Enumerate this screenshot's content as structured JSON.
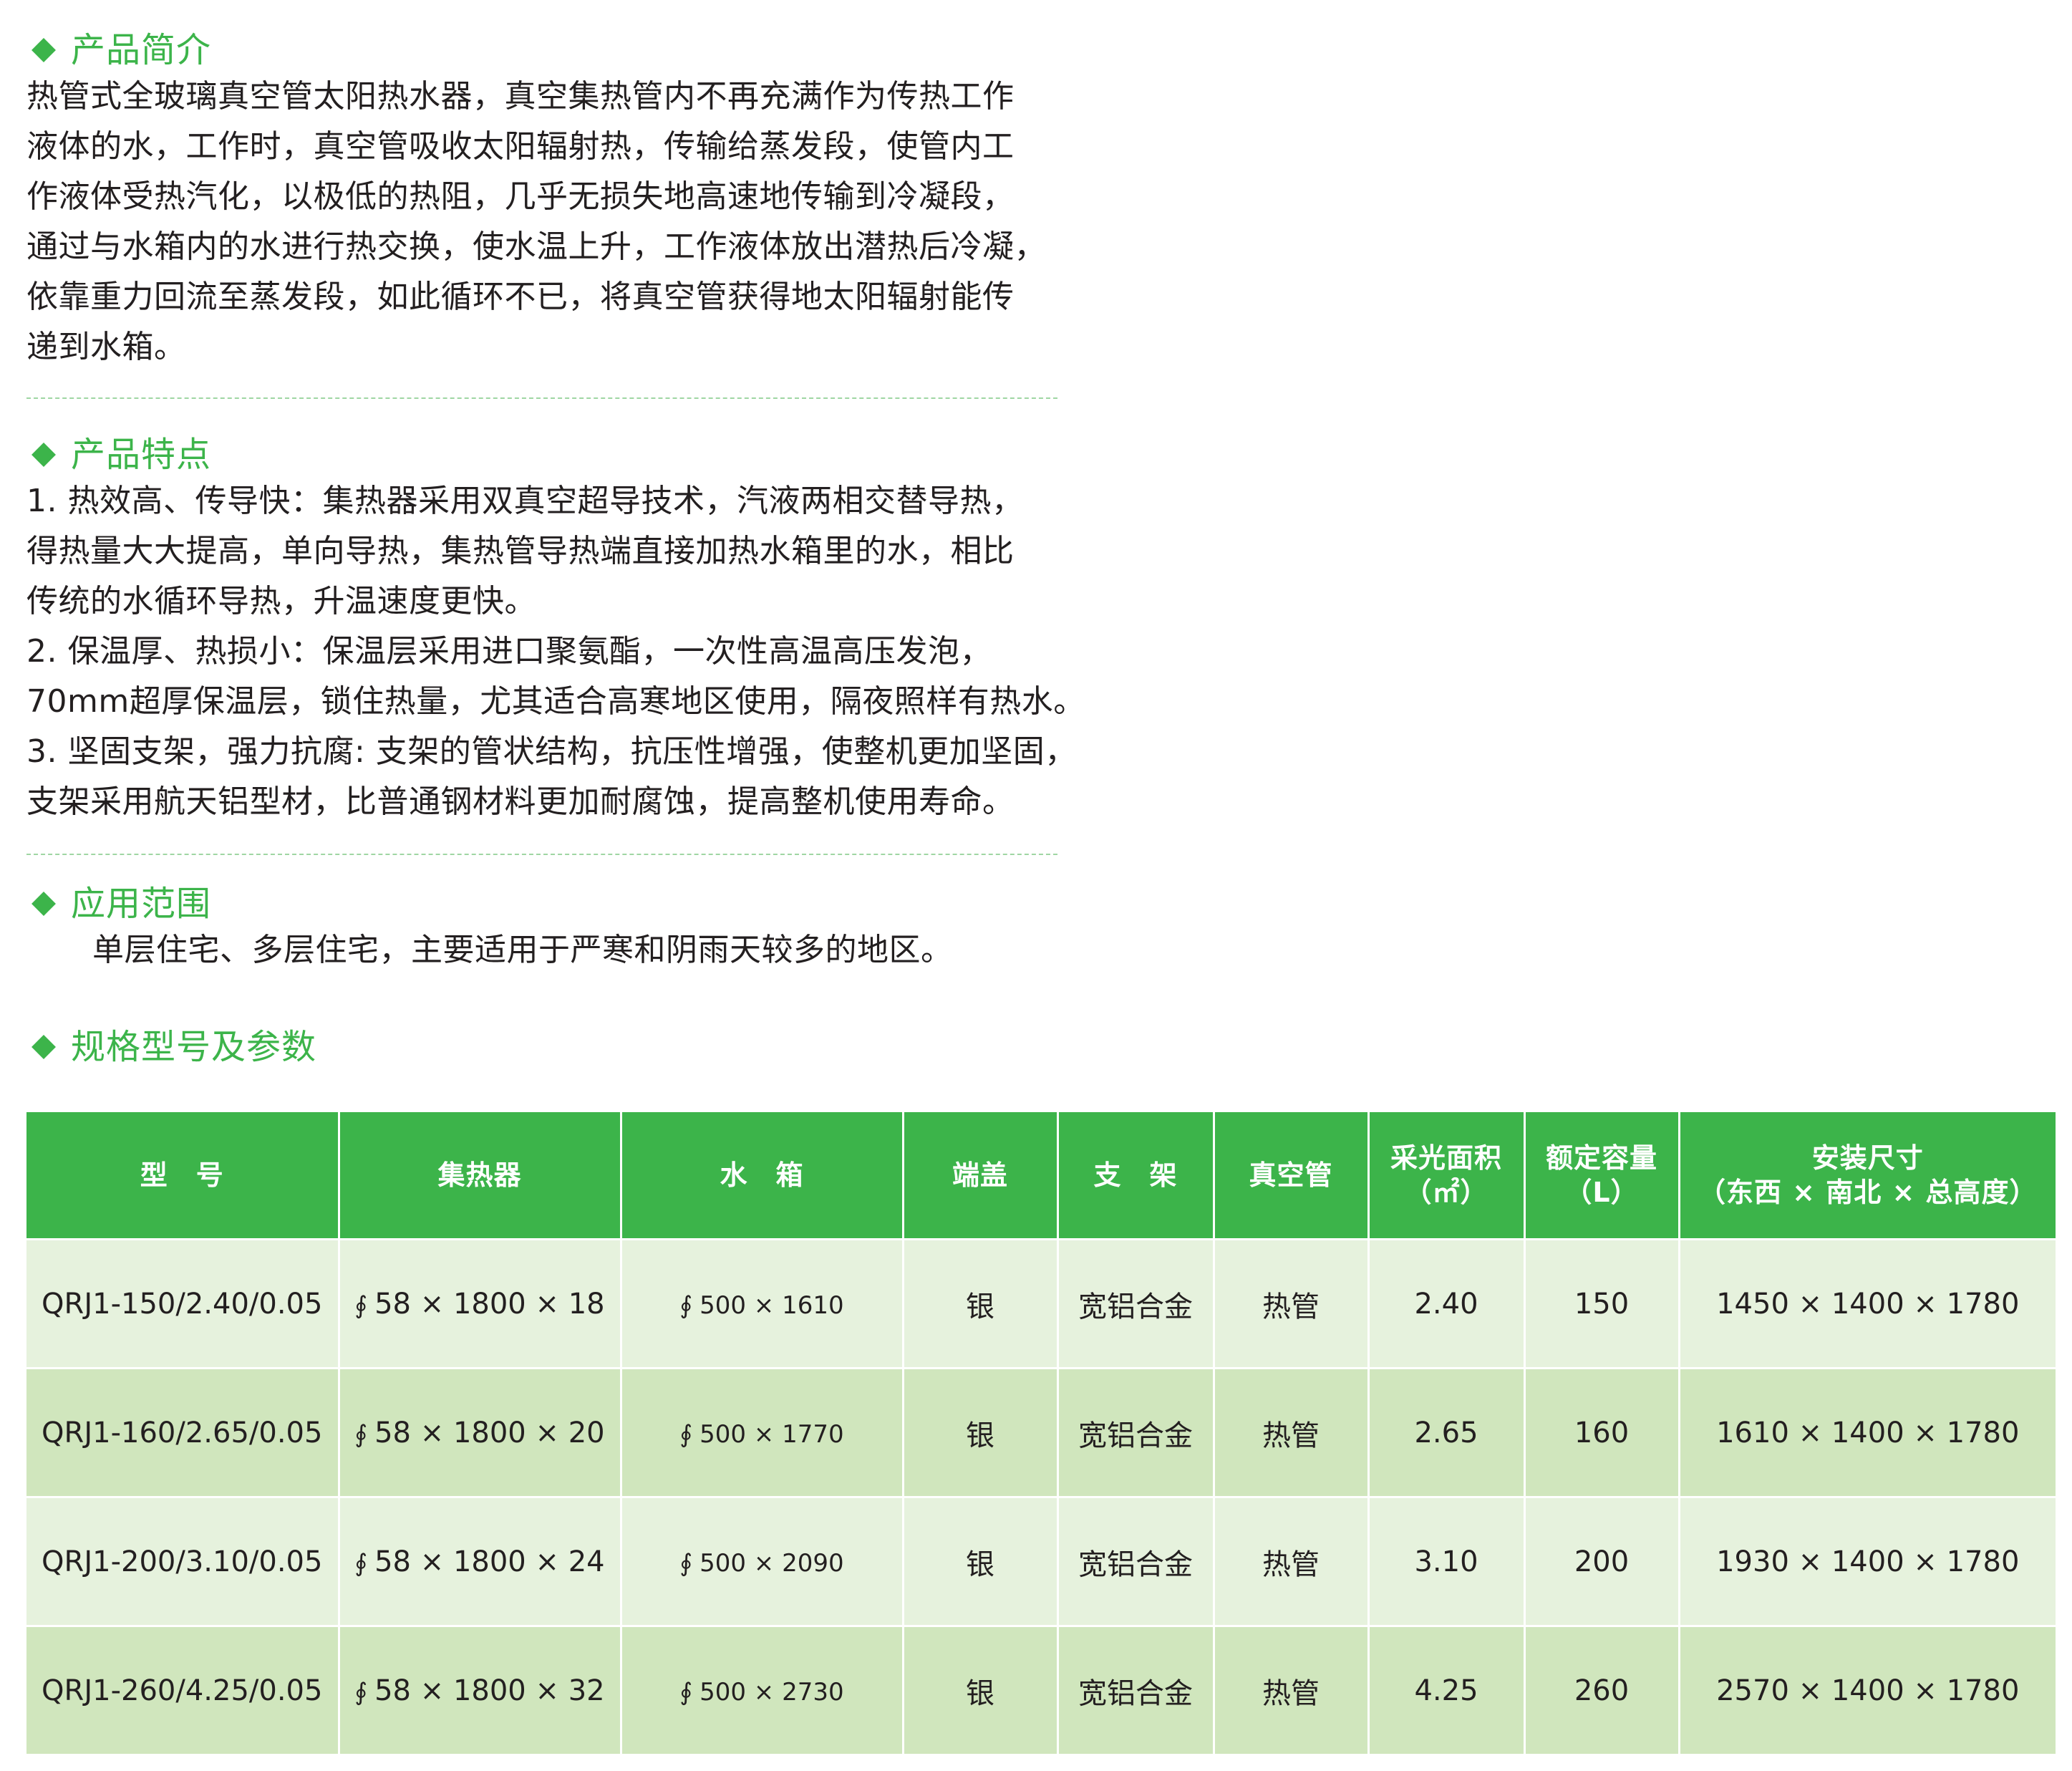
{
  "intro": {
    "title": "产品简介",
    "lines": [
      "热管式全玻璃真空管太阳热水器，真空集热管内不再充满作为传热工作",
      "液体的水，工作时，真空管吸收太阳辐射热，传输给蒸发段，使管内工",
      "作液体受热汽化，以极低的热阻，几乎无损失地高速地传输到冷凝段，",
      "通过与水箱内的水进行热交换，使水温上升，工作液体放出潜热后冷凝，",
      "依靠重力回流至蒸发段，如此循环不已，将真空管获得地太阳辐射能传",
      "递到水箱。"
    ]
  },
  "features": {
    "title": "产品特点",
    "lines": [
      "1. 热效高、传导快：集热器采用双真空超导技术，汽液两相交替导热，",
      "得热量大大提高，单向导热，集热管导热端直接加热水箱里的水，相比",
      "传统的水循环导热，升温速度更快。",
      "2. 保温厚、热损小：保温层采用进口聚氨酯，一次性高温高压发泡，",
      "70mm超厚保温层，锁住热量，尤其适合高寒地区使用，隔夜照样有热水。",
      "3. 坚固支架，强力抗腐: 支架的管状结构，抗压性增强，使整机更加坚固，",
      "支架采用航天铝型材，比普通钢材料更加耐腐蚀，提高整机使用寿命。"
    ]
  },
  "application": {
    "title": "应用范围",
    "text": "单层住宅、多层住宅，主要适用于严寒和阴雨天较多的地区。"
  },
  "specs": {
    "title": "规格型号及参数",
    "headers": {
      "model": "型　号",
      "collector": "集热器",
      "tank": "水　箱",
      "cap": "端盖",
      "bracket": "支　架",
      "tube": "真空管",
      "area_l1": "采光面积",
      "area_l2": "（㎡）",
      "capacity_l1": "额定容量",
      "capacity_l2": "（L）",
      "install_l1": "安装尺寸",
      "install_l2": "（东西 × 南北 × 总高度）"
    },
    "phi_symbol": "∮",
    "rows": [
      {
        "model": "QRJ1-150/2.40/0.05",
        "collector": "58 × 1800 × 18",
        "tank": "500 × 1610",
        "cap": "银",
        "bracket": "宽铝合金",
        "tube": "热管",
        "area": "2.40",
        "capacity": "150",
        "install": "1450 × 1400 × 1780"
      },
      {
        "model": "QRJ1-160/2.65/0.05",
        "collector": "58 × 1800 × 20",
        "tank": "500 × 1770",
        "cap": "银",
        "bracket": "宽铝合金",
        "tube": "热管",
        "area": "2.65",
        "capacity": "160",
        "install": "1610 × 1400 × 1780"
      },
      {
        "model": "QRJ1-200/3.10/0.05",
        "collector": "58 × 1800 × 24",
        "tank": "500 × 2090",
        "cap": "银",
        "bracket": "宽铝合金",
        "tube": "热管",
        "area": "3.10",
        "capacity": "200",
        "install": "1930 × 1400 × 1780"
      },
      {
        "model": "QRJ1-260/4.25/0.05",
        "collector": "58 × 1800 × 32",
        "tank": "500 × 2730",
        "cap": "银",
        "bracket": "宽铝合金",
        "tube": "热管",
        "area": "4.25",
        "capacity": "260",
        "install": "2570 × 1400 × 1780"
      }
    ]
  },
  "colors": {
    "accent": "#3cb44a",
    "row_light": "#e6f2dd",
    "row_dark": "#d0e6bd",
    "separator": "#9fd6a3"
  }
}
